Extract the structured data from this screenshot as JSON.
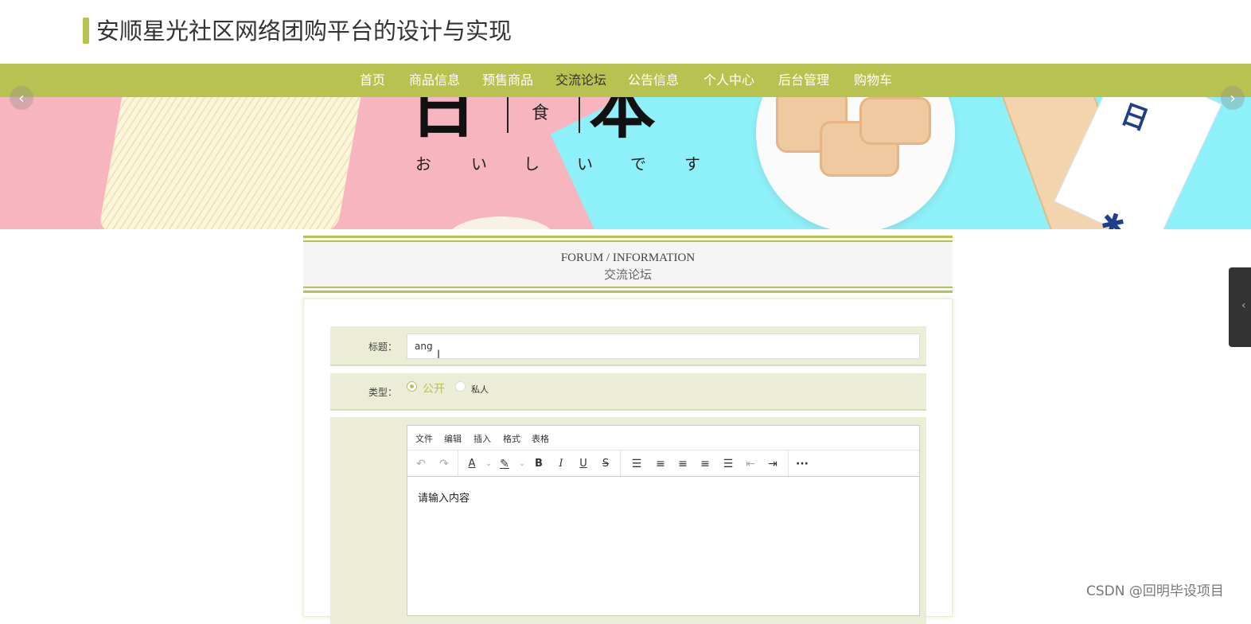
{
  "site": {
    "title": "安顺星光社区网络团购平台的设计与实现",
    "accent": "#b8c250"
  },
  "nav": {
    "items": [
      {
        "label": "首页",
        "active": false
      },
      {
        "label": "商品信息",
        "active": false
      },
      {
        "label": "预售商品",
        "active": false
      },
      {
        "label": "交流论坛",
        "active": true
      },
      {
        "label": "公告信息",
        "active": false
      },
      {
        "label": "个人中心",
        "active": false
      },
      {
        "label": "后台管理",
        "active": false
      },
      {
        "label": "购物车",
        "active": false
      }
    ]
  },
  "banner": {
    "glyph_left": "日",
    "glyph_small": "食",
    "glyph_right": "本",
    "hiragana": [
      "お",
      "い",
      "し",
      "い",
      "で",
      "す"
    ],
    "prev_icon": "chevron-left-icon",
    "next_icon": "chevron-right-icon"
  },
  "section": {
    "en": "FORUM / INFORMATION",
    "cn": "交流论坛"
  },
  "form": {
    "title_label": "标题：",
    "title_value": "ang",
    "type_label": "类型：",
    "type_options": [
      {
        "label": "公开",
        "selected": true
      },
      {
        "label": "私人",
        "selected": false
      }
    ],
    "editor": {
      "menu": [
        "文件",
        "编辑",
        "插入",
        "格式",
        "表格"
      ],
      "toolbar_icons": [
        "undo-icon",
        "redo-icon",
        "font-color-icon",
        "highlight-color-icon",
        "bold-icon",
        "italic-icon",
        "underline-icon",
        "strikethrough-icon",
        "list-icon",
        "align-left-icon",
        "align-center-icon",
        "align-right-icon",
        "align-justify-icon",
        "outdent-icon",
        "indent-icon",
        "more-icon"
      ],
      "placeholder": "请输入内容"
    }
  },
  "watermark": "CSDN @回明毕设项目"
}
